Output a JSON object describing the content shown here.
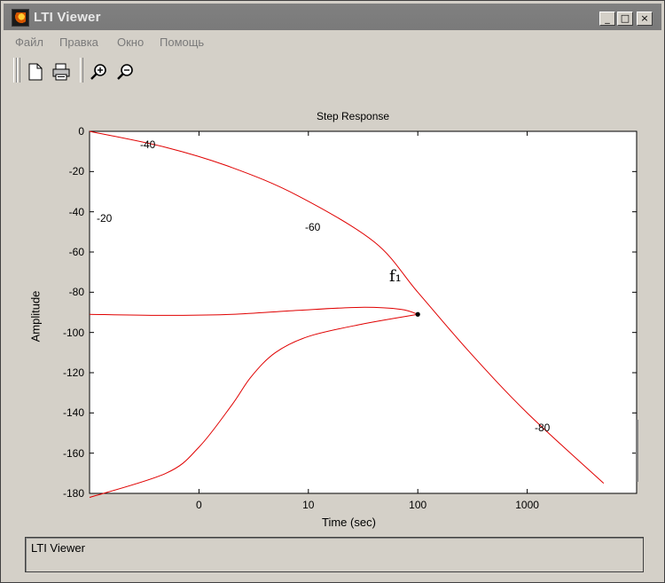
{
  "window": {
    "title": "LTI Viewer",
    "controls": {
      "minimize": "_",
      "maximize": "□",
      "close": "×"
    }
  },
  "menu": [
    "Файл",
    "Правка",
    "Окно",
    "Помощь"
  ],
  "toolbar": {
    "icons": [
      "new-file-icon",
      "print-icon",
      "zoom-in-icon",
      "zoom-out-icon"
    ]
  },
  "status": {
    "text": "LTI Viewer"
  },
  "chart_data": {
    "type": "line",
    "title": "Step Response",
    "xlabel": "Time (sec)",
    "ylabel": "Amplitude",
    "x_scale": "log",
    "xlim": [
      0.1,
      10000
    ],
    "ylim": [
      -180,
      0
    ],
    "yticks": [
      0,
      -20,
      -40,
      -60,
      -80,
      -100,
      -120,
      -140,
      -160,
      -180
    ],
    "xtick_labels": [
      "0",
      "10",
      "100",
      "1000"
    ],
    "xtick_values": [
      1,
      10,
      100,
      1000
    ],
    "series": [
      {
        "points": [
          [
            0.1,
            0
          ],
          [
            0.5,
            -8
          ],
          [
            2,
            -18
          ],
          [
            8,
            -32
          ],
          [
            40,
            -55
          ],
          [
            100,
            -80
          ],
          [
            300,
            -110
          ],
          [
            1000,
            -140
          ],
          [
            5000,
            -175
          ]
        ]
      },
      {
        "points": [
          [
            0.1,
            -91
          ],
          [
            0.5,
            -91.5
          ],
          [
            2,
            -91
          ],
          [
            8,
            -89
          ],
          [
            30,
            -87.5
          ],
          [
            70,
            -88.5
          ],
          [
            100,
            -91
          ]
        ]
      },
      {
        "points": [
          [
            0.1,
            -182
          ],
          [
            0.5,
            -170
          ],
          [
            1,
            -157
          ],
          [
            2,
            -136
          ],
          [
            3,
            -122
          ],
          [
            5,
            -110
          ],
          [
            10,
            -102
          ],
          [
            30,
            -96
          ],
          [
            100,
            -91
          ]
        ]
      }
    ],
    "slope_labels": [
      "-40",
      "-20",
      "-60",
      "-80"
    ],
    "marker_label": "f₁",
    "marker": [
      100,
      -91
    ]
  }
}
